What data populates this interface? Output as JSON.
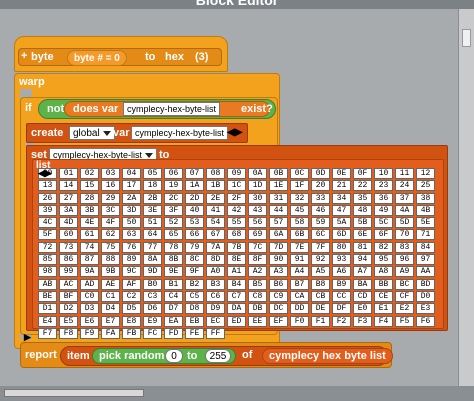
{
  "window": {
    "title": "Block Editor"
  },
  "header_block": {
    "name_left": "byte",
    "param": "byte # = 0",
    "to_word": "to",
    "name_right": "hex",
    "arity": "(3)",
    "plus": "+"
  },
  "warp": {
    "label": "warp"
  },
  "if_block": {
    "if_word": "if",
    "not_word": "not",
    "does_var": "does var",
    "var_name": "cymplecy-hex-byte-list",
    "exist": "exist?"
  },
  "create_block": {
    "create_word": "create",
    "scope": "global",
    "var_word": "var",
    "var_name": "cymplecy-hex-byte-list"
  },
  "set_block": {
    "set_word": "set",
    "var_name": "cymplecy-hex-byte-list",
    "to_word": "to"
  },
  "list_block": {
    "label": "list",
    "items": [
      "00",
      "01",
      "02",
      "03",
      "04",
      "05",
      "06",
      "07",
      "08",
      "09",
      "0A",
      "0B",
      "0C",
      "0D",
      "0E",
      "0F",
      "10",
      "11",
      "12",
      "13",
      "14",
      "15",
      "16",
      "17",
      "18",
      "19",
      "1A",
      "1B",
      "1C",
      "1D",
      "1E",
      "1F",
      "20",
      "21",
      "22",
      "23",
      "24",
      "25",
      "26",
      "27",
      "28",
      "29",
      "2A",
      "2B",
      "2C",
      "2D",
      "2E",
      "2F",
      "30",
      "31",
      "32",
      "33",
      "34",
      "35",
      "36",
      "37",
      "38",
      "39",
      "3A",
      "3B",
      "3C",
      "3D",
      "3E",
      "3F",
      "40",
      "41",
      "42",
      "43",
      "44",
      "45",
      "46",
      "47",
      "48",
      "49",
      "4A",
      "4B",
      "4C",
      "4D",
      "4E",
      "4F",
      "50",
      "51",
      "52",
      "53",
      "54",
      "55",
      "56",
      "57",
      "58",
      "59",
      "5A",
      "5B",
      "5C",
      "5D",
      "5E",
      "5F",
      "60",
      "61",
      "62",
      "63",
      "64",
      "65",
      "66",
      "67",
      "68",
      "69",
      "6A",
      "6B",
      "6C",
      "6D",
      "6E",
      "6F",
      "70",
      "71",
      "72",
      "73",
      "74",
      "75",
      "76",
      "77",
      "78",
      "79",
      "7A",
      "7B",
      "7C",
      "7D",
      "7E",
      "7F",
      "80",
      "81",
      "82",
      "83",
      "84",
      "85",
      "86",
      "87",
      "88",
      "89",
      "8A",
      "8B",
      "8C",
      "8D",
      "8E",
      "8F",
      "90",
      "91",
      "92",
      "93",
      "94",
      "95",
      "96",
      "97",
      "98",
      "99",
      "9A",
      "9B",
      "9C",
      "9D",
      "9E",
      "9F",
      "A0",
      "A1",
      "A2",
      "A3",
      "A4",
      "A5",
      "A6",
      "A7",
      "A8",
      "A9",
      "AA",
      "AB",
      "AC",
      "AD",
      "AE",
      "AF",
      "B0",
      "B1",
      "B2",
      "B3",
      "B4",
      "B5",
      "B6",
      "B7",
      "B8",
      "B9",
      "BA",
      "BB",
      "BC",
      "BD",
      "BE",
      "BF",
      "C0",
      "C1",
      "C2",
      "C3",
      "C4",
      "C5",
      "C6",
      "C7",
      "C8",
      "C9",
      "CA",
      "CB",
      "CC",
      "CD",
      "CE",
      "CF",
      "D0",
      "D1",
      "D2",
      "D3",
      "D4",
      "D5",
      "D6",
      "D7",
      "D8",
      "D9",
      "DA",
      "DB",
      "DC",
      "DD",
      "DE",
      "DF",
      "E0",
      "E1",
      "E2",
      "E3",
      "E4",
      "E5",
      "E6",
      "E7",
      "E8",
      "E9",
      "EA",
      "EB",
      "EC",
      "ED",
      "EE",
      "EF",
      "F0",
      "F1",
      "F2",
      "F3",
      "F4",
      "F5",
      "F6",
      "F7",
      "F8",
      "F9",
      "FA",
      "FB",
      "FC",
      "FD",
      "FE",
      "FF"
    ]
  },
  "report_block": {
    "report_word": "report",
    "item_word": "item",
    "pick_random": "pick random",
    "from": "0",
    "to_word": "to",
    "to_value": "255",
    "of_word": "of",
    "list_var": "cymplecy hex byte list"
  },
  "icons": {
    "arrows": "left-right-arrows-icon",
    "expand": "right-arrow-icon"
  },
  "colors": {
    "control": "#f3a21d",
    "variables": "#d25212",
    "operators": "#5db34a",
    "canvas": "#a8abae"
  }
}
